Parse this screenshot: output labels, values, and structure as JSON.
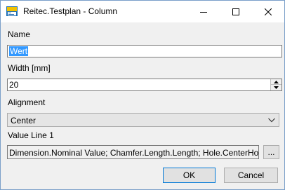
{
  "window": {
    "title": "Reitec.Testplan - Column",
    "app_icon": "reitec-app-icon",
    "controls": [
      "minimize-icon",
      "maximize-icon",
      "close-icon"
    ]
  },
  "form": {
    "name": {
      "label": "Name",
      "value": "Wert"
    },
    "width": {
      "label": "Width [mm]",
      "value": "20"
    },
    "alignment": {
      "label": "Alignment",
      "selected": "Center"
    },
    "value_line": {
      "label": "Value Line 1",
      "value": "Dimension.Nominal Value; Chamfer.Length.Length; Hole.CenterHoleDiamet",
      "browse_label": "..."
    }
  },
  "buttons": {
    "ok": "OK",
    "cancel": "Cancel"
  },
  "colors": {
    "window_border": "#7a9fc9",
    "selection": "#3399ff",
    "focus_border": "#0078d7",
    "background": "#f0f0f0"
  }
}
